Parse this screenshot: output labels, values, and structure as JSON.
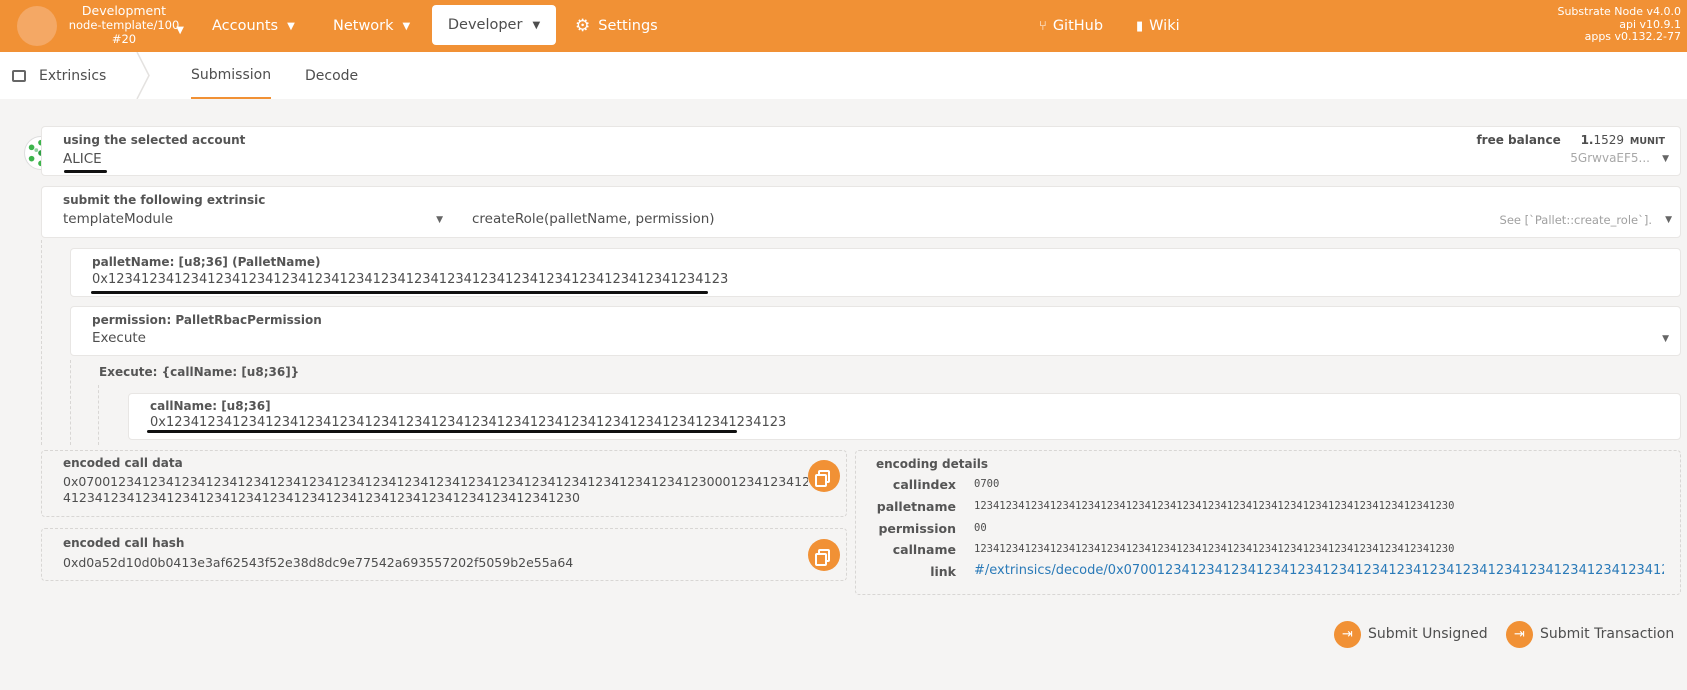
{
  "header": {
    "chain": {
      "name": "Development",
      "runtime": "node-template/100",
      "block": "#20"
    },
    "nav": {
      "accounts": "Accounts",
      "network": "Network",
      "developer": "Developer",
      "settings": "Settings",
      "github": "GitHub",
      "wiki": "Wiki"
    },
    "version": {
      "node": "Substrate Node v4.0.0",
      "api": "api v10.9.1",
      "apps": "apps v0.132.2-77"
    }
  },
  "subnav": {
    "section": "Extrinsics",
    "tabs": [
      "Submission",
      "Decode"
    ]
  },
  "account": {
    "label": "using the selected account",
    "name": "ALICE",
    "free_balance_label": "free balance",
    "balance_int": "1.",
    "balance_dec": "1529",
    "balance_unit": "MUNIT",
    "address": "5GrwvaEF5..."
  },
  "extrinsic": {
    "label": "submit the following extrinsic",
    "module": "templateModule",
    "method": "createRole(palletName, permission)",
    "doc": "See [`Pallet::create_role`]."
  },
  "params": {
    "pallet_name_label": "palletName: [u8;36] (PalletName)",
    "pallet_name_value": "0x123412341234123412341234123412341234123412341234123412341234123412341234123",
    "permission_label": "permission: PalletRbacPermission",
    "permission_value": "Execute",
    "execute_label": "Execute: {callName: [u8;36]}",
    "call_name_label": "callName: [u8;36]",
    "call_name_value": "0x123412341234123412341234123412341234123412341234123412341234123412341234123"
  },
  "encoded": {
    "call_data_label": "encoded call data",
    "call_data_line1": "0x07001234123412341234123412341234123412341234123412341234123412341234123412341230001234123412341234123",
    "call_data_line2": "41234123412341234123412341234123412341234123412341234123412341230",
    "call_hash_label": "encoded call hash",
    "call_hash": "0xd0a52d10d0b0413e3af62543f52e38d8dc9e77542a693557202f5059b2e55a64"
  },
  "details": {
    "title": "encoding details",
    "callindex_key": "callindex",
    "callindex": "0700",
    "palletname_key": "palletname",
    "palletname": "1234123412341234123412341234123412341234123412341234123412341234123412341230",
    "permission_key": "permission",
    "permission": "00",
    "callname_key": "callname",
    "callname": "1234123412341234123412341234123412341234123412341234123412341234123412341230",
    "link_key": "link",
    "link": "#/extrinsics/decode/0x07001234123412341234123412341234123412341234123412341234123412341234..."
  },
  "actions": {
    "submit_unsigned": "Submit Unsigned",
    "submit_transaction": "Submit Transaction"
  },
  "colors": {
    "accent": "#f19135",
    "link": "#2a7ab8"
  }
}
